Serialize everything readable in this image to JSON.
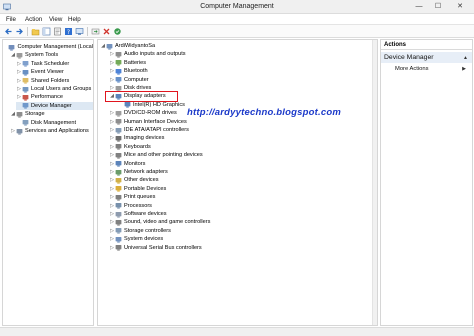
{
  "window": {
    "title": "Computer Management"
  },
  "controls": {
    "minimize": "—",
    "maximize": "☐",
    "close": "✕"
  },
  "menu": [
    "File",
    "Action",
    "View",
    "Help"
  ],
  "left_tree": [
    {
      "label": "Computer Management (Local",
      "level": 0,
      "expander": "",
      "icon": "computer-management-icon",
      "color": "#5b7bb0"
    },
    {
      "label": "System Tools",
      "level": 1,
      "expander": "◢",
      "icon": "system-tools-icon",
      "color": "#8a8a8a"
    },
    {
      "label": "Task Scheduler",
      "level": 2,
      "expander": "▷",
      "icon": "task-scheduler-icon",
      "color": "#6a8fc4"
    },
    {
      "label": "Event Viewer",
      "level": 2,
      "expander": "▷",
      "icon": "event-viewer-icon",
      "color": "#4d7db8"
    },
    {
      "label": "Shared Folders",
      "level": 2,
      "expander": "▷",
      "icon": "shared-folders-icon",
      "color": "#d9b24a"
    },
    {
      "label": "Local Users and Groups",
      "level": 2,
      "expander": "▷",
      "icon": "local-users-icon",
      "color": "#5c86b7"
    },
    {
      "label": "Performance",
      "level": 2,
      "expander": "▷",
      "icon": "performance-icon",
      "color": "#c0392b"
    },
    {
      "label": "Device Manager",
      "level": 2,
      "expander": "",
      "icon": "device-manager-icon",
      "color": "#5d8ac2"
    },
    {
      "label": "Storage",
      "level": 1,
      "expander": "◢",
      "icon": "storage-icon",
      "color": "#7a7a7a"
    },
    {
      "label": "Disk Management",
      "level": 2,
      "expander": "",
      "icon": "disk-management-icon",
      "color": "#6f8fb3"
    },
    {
      "label": "Services and Applications",
      "level": 1,
      "expander": "▷",
      "icon": "services-icon",
      "color": "#6b7f99"
    }
  ],
  "device_tree": [
    {
      "label": "ArdiWidyantoSa",
      "level": 0,
      "expander": "◢",
      "icon": "computer-icon",
      "color": "#5a7fb3"
    },
    {
      "label": "Audio inputs and outputs",
      "level": 1,
      "expander": "▷",
      "icon": "audio-icon",
      "color": "#7a7a7a"
    },
    {
      "label": "Batteries",
      "level": 1,
      "expander": "▷",
      "icon": "battery-icon",
      "color": "#5b9b3b"
    },
    {
      "label": "Bluetooth",
      "level": 1,
      "expander": "▷",
      "icon": "bluetooth-icon",
      "color": "#2f6fd1"
    },
    {
      "label": "Computer",
      "level": 1,
      "expander": "▷",
      "icon": "computer-icon",
      "color": "#4f7fbf"
    },
    {
      "label": "Disk drives",
      "level": 1,
      "expander": "▷",
      "icon": "disk-icon",
      "color": "#8a8a8a"
    },
    {
      "label": "Display adapters",
      "level": 1,
      "expander": "◢",
      "icon": "display-adapter-icon",
      "color": "#3f6fae"
    },
    {
      "label": "Intel(R) HD Graphics",
      "level": 2,
      "expander": "",
      "icon": "display-adapter-icon",
      "color": "#3f6fae"
    },
    {
      "label": "DVD/CD-ROM drives",
      "level": 1,
      "expander": "▷",
      "icon": "dvd-icon",
      "color": "#8c8c8c"
    },
    {
      "label": "Human Interface Devices",
      "level": 1,
      "expander": "▷",
      "icon": "hid-icon",
      "color": "#7a7a7a"
    },
    {
      "label": "IDE ATA/ATAPI controllers",
      "level": 1,
      "expander": "▷",
      "icon": "ide-icon",
      "color": "#6f8aa8"
    },
    {
      "label": "Imaging devices",
      "level": 1,
      "expander": "▷",
      "icon": "camera-icon",
      "color": "#555555"
    },
    {
      "label": "Keyboards",
      "level": 1,
      "expander": "▷",
      "icon": "keyboard-icon",
      "color": "#6a6a6a"
    },
    {
      "label": "Mice and other pointing devices",
      "level": 1,
      "expander": "▷",
      "icon": "mouse-icon",
      "color": "#6a6a6a"
    },
    {
      "label": "Monitors",
      "level": 1,
      "expander": "▷",
      "icon": "monitor-icon",
      "color": "#3f6fae"
    },
    {
      "label": "Network adapters",
      "level": 1,
      "expander": "▷",
      "icon": "network-icon",
      "color": "#4f8a4f"
    },
    {
      "label": "Other devices",
      "level": 1,
      "expander": "▷",
      "icon": "unknown-device-icon",
      "color": "#c9a227"
    },
    {
      "label": "Portable Devices",
      "level": 1,
      "expander": "▷",
      "icon": "portable-device-icon",
      "color": "#d4a017"
    },
    {
      "label": "Print queues",
      "level": 1,
      "expander": "▷",
      "icon": "printer-icon",
      "color": "#6a6a6a"
    },
    {
      "label": "Processors",
      "level": 1,
      "expander": "▷",
      "icon": "processor-icon",
      "color": "#5f7c9c"
    },
    {
      "label": "Software devices",
      "level": 1,
      "expander": "▷",
      "icon": "software-device-icon",
      "color": "#7a8aa0"
    },
    {
      "label": "Sound, video and game controllers",
      "level": 1,
      "expander": "▷",
      "icon": "sound-icon",
      "color": "#6a6a6a"
    },
    {
      "label": "Storage controllers",
      "level": 1,
      "expander": "▷",
      "icon": "storage-controller-icon",
      "color": "#6f8aa8"
    },
    {
      "label": "System devices",
      "level": 1,
      "expander": "▷",
      "icon": "system-device-icon",
      "color": "#5a7fb3"
    },
    {
      "label": "Universal Serial Bus controllers",
      "level": 1,
      "expander": "▷",
      "icon": "usb-icon",
      "color": "#6a6a6a"
    }
  ],
  "watermark": "http://ardyytechno.blogspot.com",
  "actions": {
    "header": "Actions",
    "section": "Device Manager",
    "item": "More Actions",
    "arrow_up": "▲",
    "arrow_right": "▶"
  },
  "accent_color": "#e0151e"
}
